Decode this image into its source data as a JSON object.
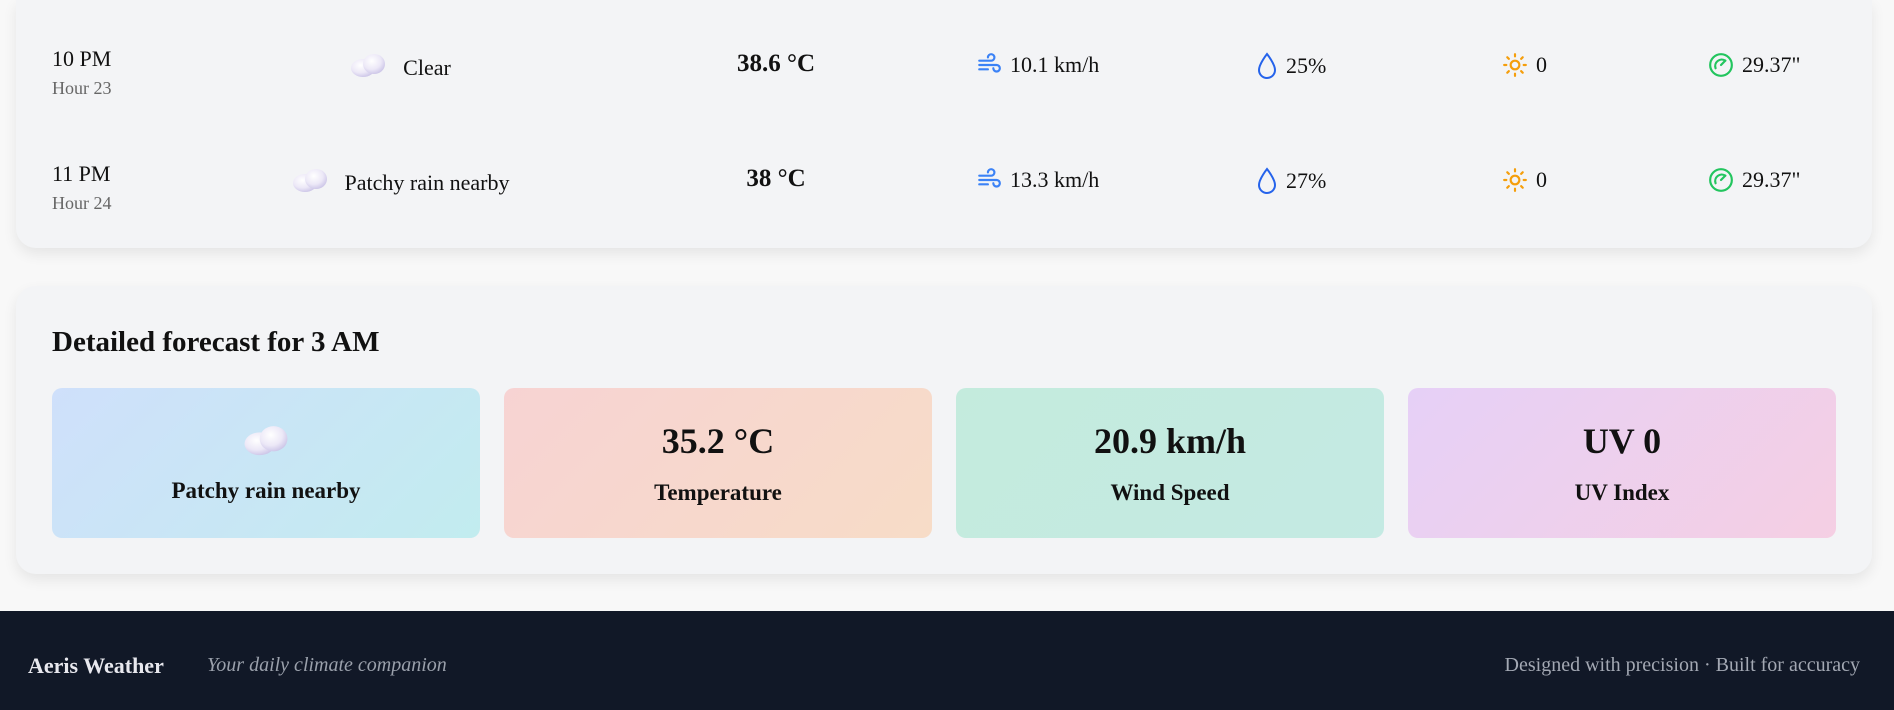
{
  "hourly": [
    {
      "time": "10 PM",
      "hour_label": "Hour 23",
      "condition": "Clear",
      "condition_icon": "cloud-icon",
      "temp": "38.6 °C",
      "wind": "10.1 km/h",
      "humidity": "25%",
      "uv": "0",
      "pressure": "29.37\""
    },
    {
      "time": "11 PM",
      "hour_label": "Hour 24",
      "condition": "Patchy rain nearby",
      "condition_icon": "cloud-icon",
      "temp": "38 °C",
      "wind": "13.3 km/h",
      "humidity": "27%",
      "uv": "0",
      "pressure": "29.37\""
    }
  ],
  "detail": {
    "title": "Detailed forecast for 3 AM",
    "condition": "Patchy rain nearby",
    "temperature_value": "35.2 °C",
    "temperature_label": "Temperature",
    "wind_value": "20.9 km/h",
    "wind_label": "Wind Speed",
    "uv_value": "UV 0",
    "uv_label": "UV Index"
  },
  "footer": {
    "brand": "Aeris Weather",
    "tagline": "Your daily climate companion",
    "right_text": "Designed with precision · Built for accuracy"
  },
  "icons": {
    "wind": "wind-icon",
    "humidity": "droplet-icon",
    "uv": "sun-icon",
    "pressure": "gauge-icon",
    "cloud": "cloud-icon"
  },
  "colors": {
    "wind_icon": "#3b82f6",
    "humidity_icon": "#2563eb",
    "uv_icon": "#f59e0b",
    "pressure_icon": "#22c55e",
    "footer_bg": "#111827"
  }
}
